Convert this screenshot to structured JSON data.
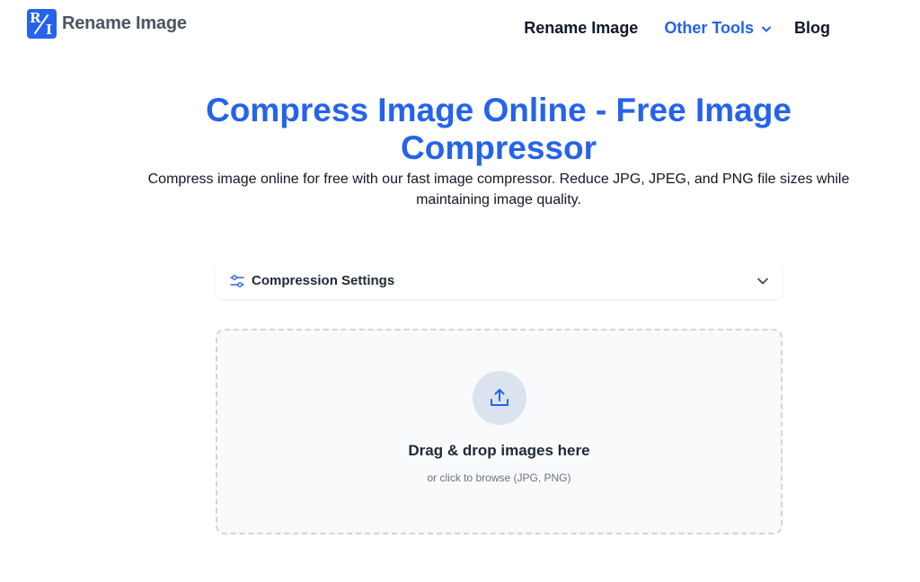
{
  "logo": {
    "text": "Rename Image",
    "mark_r": "R",
    "mark_i": "I"
  },
  "nav": {
    "rename_image": "Rename Image",
    "other_tools": "Other Tools",
    "blog": "Blog"
  },
  "hero": {
    "title": "Compress Image Online - Free Image Compressor",
    "subtitle": "Compress image online for free with our fast image compressor. Reduce JPG, JPEG, and PNG file sizes while maintaining image quality."
  },
  "settings": {
    "label": "Compression Settings"
  },
  "dropzone": {
    "title": "Drag & drop images here",
    "subtitle": "or click to browse (JPG, PNG)"
  },
  "colors": {
    "accent": "#2563eb",
    "text": "#111827",
    "muted": "#6b7280",
    "dropzone_bg": "#f9fafb"
  },
  "icons": [
    "logo-icon",
    "chevron-down-icon",
    "sliders-icon",
    "upload-icon"
  ]
}
